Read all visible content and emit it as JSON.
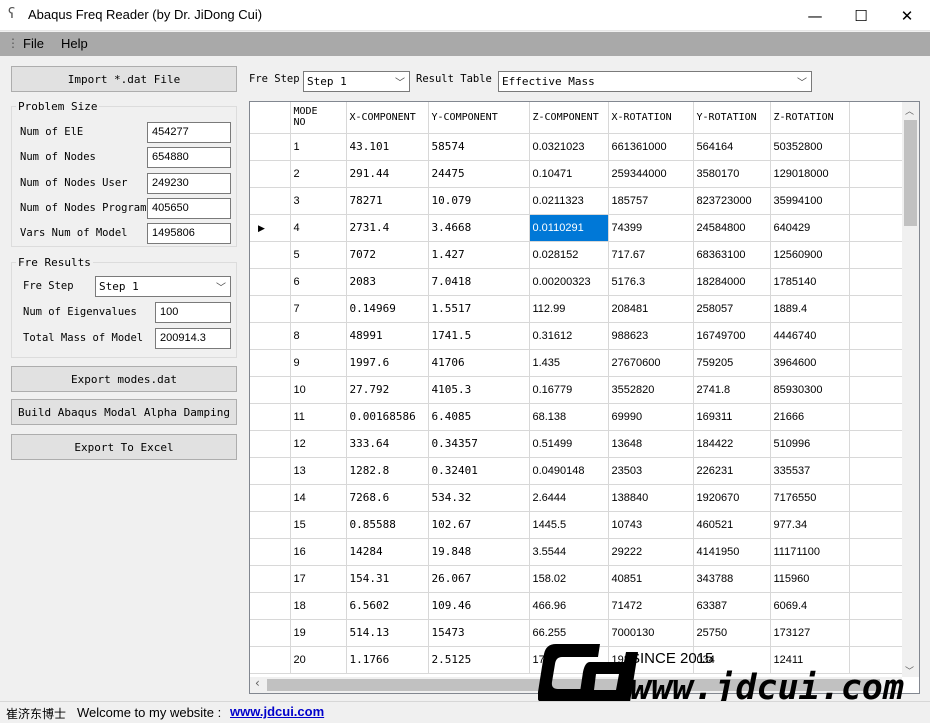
{
  "window": {
    "title": "Abaqus Freq Reader (by Dr. JiDong Cui)",
    "minimize_glyph": "—",
    "maximize_glyph": "☐",
    "close_glyph": "✕",
    "app_icon_glyph": "ʕ"
  },
  "menu": [
    "File",
    "Help"
  ],
  "menu_grip_glyph": "⋮",
  "left": {
    "import_button": "Import *.dat File",
    "problem_size": {
      "title": "Problem Size",
      "fields": [
        {
          "label": "Num of ElE",
          "value": "454277"
        },
        {
          "label": "Num of Nodes",
          "value": "654880"
        },
        {
          "label": "Num of Nodes User",
          "value": "249230"
        },
        {
          "label": "Num of Nodes Program",
          "value": "405650"
        },
        {
          "label": "Vars Num of Model",
          "value": "1495806"
        }
      ]
    },
    "fre_results": {
      "title": "Fre Results",
      "fre_step_label": "Fre Step",
      "fre_step_value": "Step 1",
      "num_eigen_label": "Num of Eigenvalues",
      "num_eigen_value": "100",
      "total_mass_label": "Total Mass of Model",
      "total_mass_value": "200914.3"
    },
    "export_modes_button": "Export  modes.dat",
    "build_damping_button": "Build Abaqus Modal Alpha Damping",
    "export_excel_button": "Export To Excel"
  },
  "top": {
    "fre_step_label": "Fre Step",
    "fre_step_value": "Step 1",
    "result_table_label": "Result Table",
    "result_table_value": "Effective Mass"
  },
  "table": {
    "headers": [
      "MODE\nNO",
      "X-COMPONENT",
      "Y-COMPONENT",
      "Z-COMPONENT",
      "X-ROTATION",
      "Y-ROTATION",
      "Z-ROTATION"
    ],
    "current_row_indicator": "▶",
    "selected": {
      "row": 3,
      "col": 2
    },
    "rows": [
      [
        "1",
        "43.101",
        "58574",
        "0.0321023",
        "661361000",
        "564164",
        "50352800"
      ],
      [
        "2",
        "291.44",
        "24475",
        "0.10471",
        "259344000",
        "3580170",
        "129018000"
      ],
      [
        "3",
        "78271",
        "10.079",
        "0.0211323",
        "185757",
        "823723000",
        "35994100"
      ],
      [
        "4",
        "2731.4",
        "3.4668",
        "0.0110291",
        "74399",
        "24584800",
        "640429"
      ],
      [
        "5",
        "7072",
        "1.427",
        "0.028152",
        "717.67",
        "68363100",
        "12560900"
      ],
      [
        "6",
        "2083",
        "7.0418",
        "0.00200323",
        "5176.3",
        "18284000",
        "1785140"
      ],
      [
        "7",
        "0.14969",
        "1.5517",
        "112.99",
        "208481",
        "258057",
        "1889.4"
      ],
      [
        "8",
        "48991",
        "1741.5",
        "0.31612",
        "988623",
        "16749700",
        "4446740"
      ],
      [
        "9",
        "1997.6",
        "41706",
        "1.435",
        "27670600",
        "759205",
        "3964600"
      ],
      [
        "10",
        "27.792",
        "4105.3",
        "0.16779",
        "3552820",
        "2741.8",
        "85930300"
      ],
      [
        "11",
        "0.00168586",
        "6.4085",
        "68.138",
        "69990",
        "169311",
        "21666"
      ],
      [
        "12",
        "333.64",
        "0.34357",
        "0.51499",
        "13648",
        "184422",
        "510996"
      ],
      [
        "13",
        "1282.8",
        "0.32401",
        "0.0490148",
        "23503",
        "226231",
        "335537"
      ],
      [
        "14",
        "7268.6",
        "534.32",
        "2.6444",
        "138840",
        "1920670",
        "7176550"
      ],
      [
        "15",
        "0.85588",
        "102.67",
        "1445.5",
        "10743",
        "460521",
        "977.34"
      ],
      [
        "16",
        "14284",
        "19.848",
        "3.5544",
        "29222",
        "4141950",
        "11171100"
      ],
      [
        "17",
        "154.31",
        "26.067",
        "158.02",
        "40851",
        "343788",
        "115960"
      ],
      [
        "18",
        "6.5602",
        "109.46",
        "466.96",
        "71472",
        "63387",
        "6069.4"
      ],
      [
        "19",
        "514.13",
        "15473",
        "66.255",
        "7000130",
        "25750",
        "173127"
      ],
      [
        "20",
        "1.1766",
        "2.5125",
        "177",
        "192",
        "034",
        "12411"
      ]
    ]
  },
  "status": {
    "author": "崔济东博士",
    "welcome": "Welcome to my website :",
    "link": "www.jdcui.com"
  },
  "watermark": {
    "since": "SINCE 2015",
    "url": "www.jdcui.com"
  },
  "scroll_glyphs": {
    "up": "︿",
    "down": "﹀",
    "left": "‹",
    "right": "›"
  },
  "colors": {
    "selection": "#0078d7",
    "menubar": "#a9a9a9",
    "link": "#0000cc"
  }
}
